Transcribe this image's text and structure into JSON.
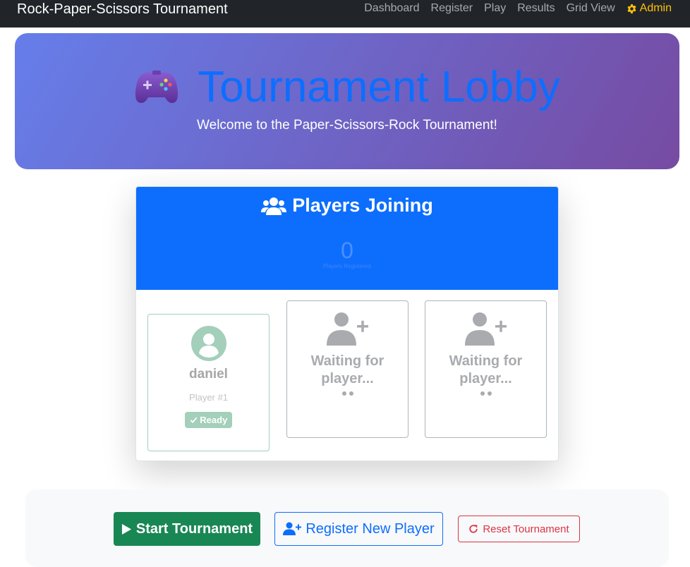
{
  "navbar": {
    "brand": "Rock-Paper-Scissors Tournament",
    "links": [
      "Dashboard",
      "Register",
      "Play",
      "Results",
      "Grid View"
    ],
    "admin_label": "Admin",
    "admin_icon": "gear-icon",
    "admin_color": "#ffc107"
  },
  "hero": {
    "icon": "gamepad-icon",
    "title": "Tournament Lobby",
    "subtitle": "Welcome to the Paper-Scissors-Rock Tournament!"
  },
  "players": {
    "icon": "users-icon",
    "title": "Players Joining",
    "count": "0",
    "count_label": "Players Registered",
    "slots": [
      {
        "state": "joined",
        "icon": "user-circle-icon",
        "name": "daniel",
        "number": "Player #1",
        "badge": "Ready",
        "badge_icon": "check-icon"
      },
      {
        "state": "waiting",
        "icon": "user-plus-icon",
        "text": "Waiting for player..."
      },
      {
        "state": "waiting",
        "icon": "user-plus-icon",
        "text": "Waiting for player..."
      }
    ]
  },
  "controls": {
    "start_label": "Start Tournament",
    "start_icon": "play-icon",
    "register_label": "Register New Player",
    "register_icon": "user-plus-icon",
    "reset_label": "Reset Tournament",
    "reset_icon": "redo-icon"
  },
  "colors": {
    "primary": "#0d6efd",
    "success": "#198754",
    "danger": "#dc3545",
    "navbar": "#212529"
  }
}
